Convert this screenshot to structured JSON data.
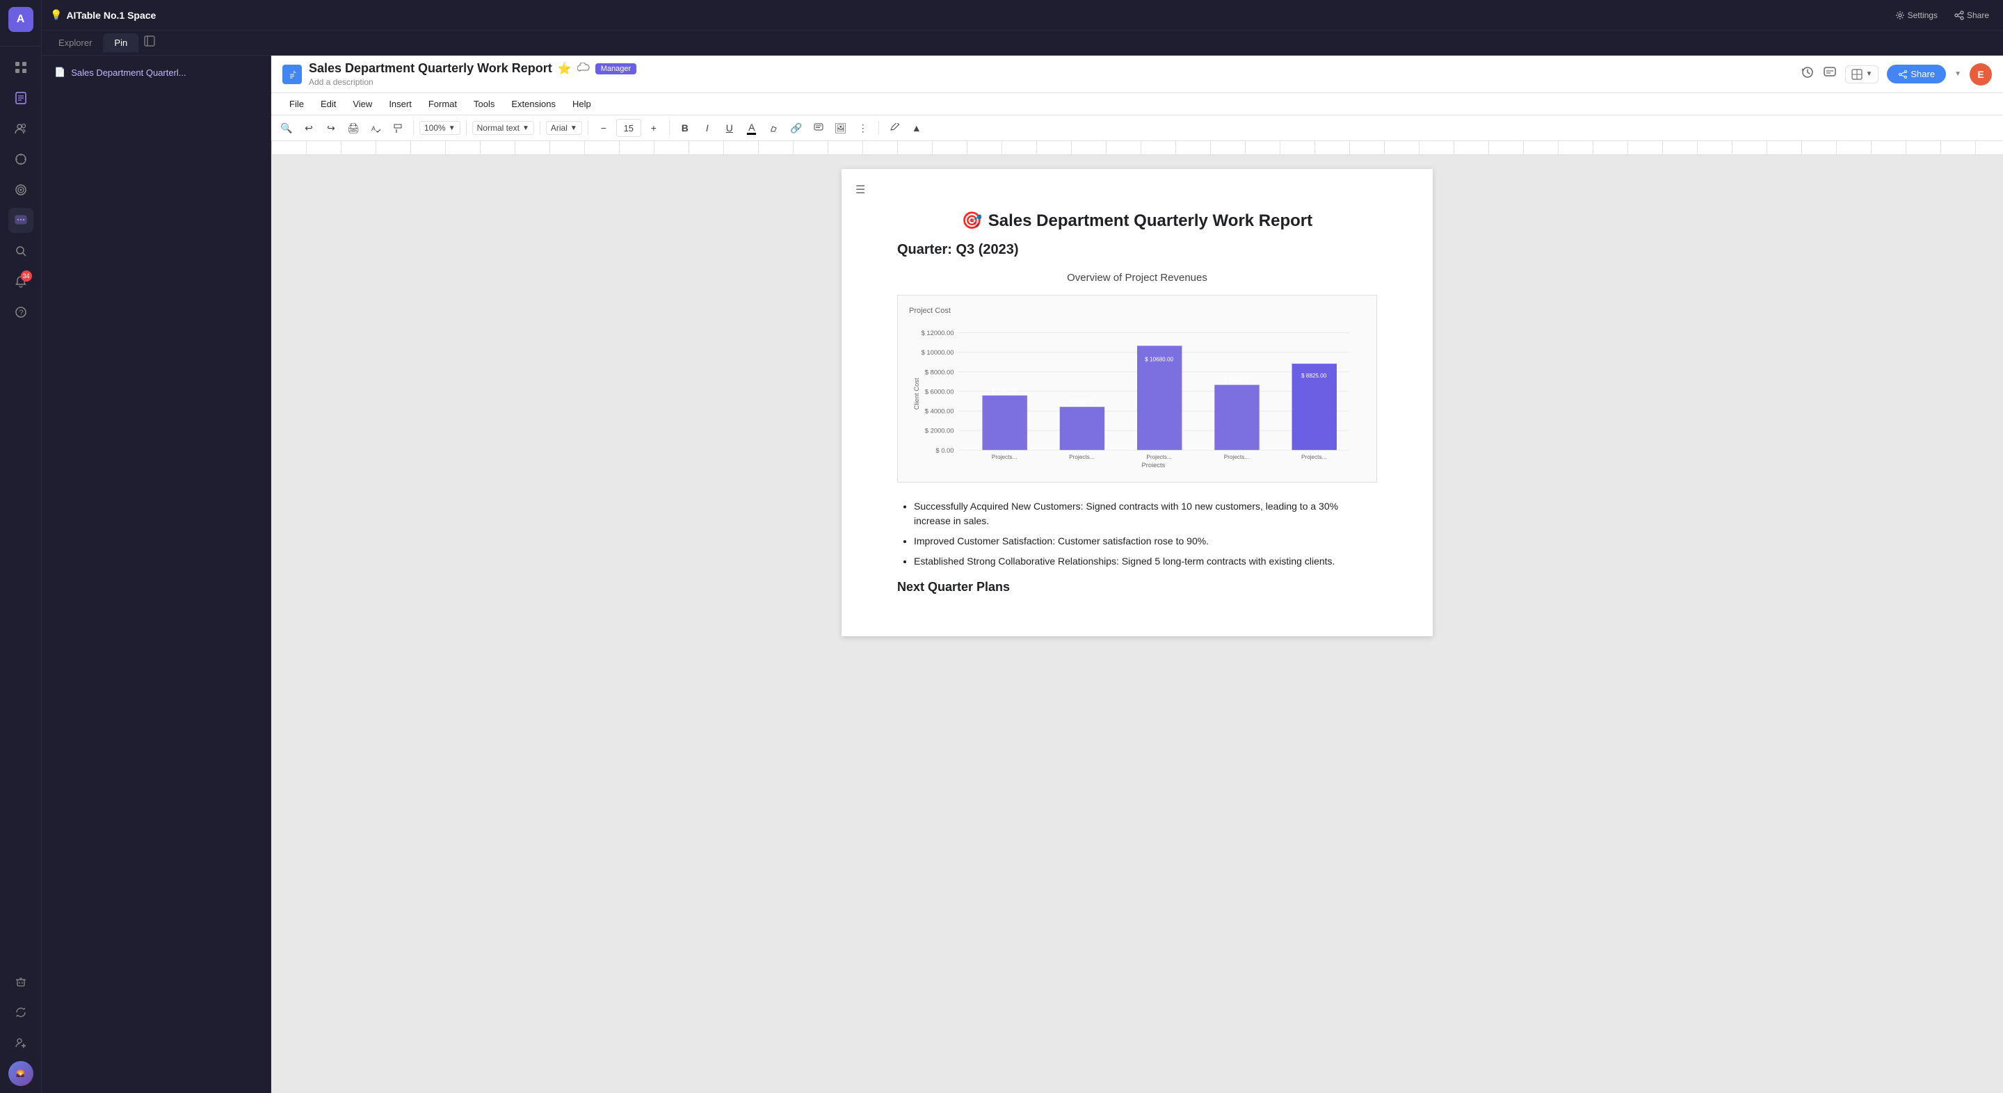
{
  "app": {
    "title": "AITable No.1 Space",
    "avatar_letter": "A"
  },
  "top_bar": {
    "title": "AITable No.1 Space",
    "settings_label": "Settings",
    "share_label": "Share"
  },
  "nav": {
    "explorer_label": "Explorer",
    "pin_label": "Pin"
  },
  "sidebar": {
    "icons": [
      "🏠",
      "📋",
      "👥",
      "🔭",
      "🎯",
      "💬",
      "🔍",
      "🔔",
      "❓"
    ]
  },
  "doc_nav": {
    "title": "Sales Department Quarterl...",
    "icon": "📄"
  },
  "document": {
    "title": "Sales Department Quarterly Work Report",
    "emoji": "🎯",
    "star": "★",
    "description_placeholder": "Add a description",
    "manager_badge": "Manager",
    "share_btn": "Share",
    "user_initial": "E",
    "quarter": "Quarter: Q3 (2023)",
    "chart_section_title": "Overview of Project Revenues",
    "chart_label": "Project Cost",
    "y_axis_label": "Client Cost",
    "x_axis_label": "Projects",
    "chart_bars": [
      {
        "label": "Projects...",
        "value": 5560,
        "display": "$ 5560.00"
      },
      {
        "label": "Projects...",
        "value": 4460,
        "display": "$ 4460.00"
      },
      {
        "label": "Projects...",
        "value": 10680,
        "display": "$ 10680.00"
      },
      {
        "label": "Projects...",
        "value": 6650,
        "display": "$ 6650.00"
      },
      {
        "label": "Projects...",
        "value": 8825,
        "display": "$ 8825.00"
      }
    ],
    "y_axis_values": [
      "$ 12000.00",
      "$ 10000.00",
      "$ 8000.00",
      "$ 6000.00",
      "$ 4000.00",
      "$ 2000.00",
      "$ 0.00"
    ],
    "bullet_points": [
      "Successfully Acquired New Customers: Signed contracts with 10 new customers, leading to a 30% increase in sales.",
      "Improved Customer Satisfaction: Customer satisfaction rose to 90%.",
      "Established Strong Collaborative Relationships: Signed 5 long-term contracts with existing clients."
    ],
    "next_quarter_heading": "Next Quarter Plans"
  },
  "toolbar": {
    "zoom": "100%",
    "text_style": "Normal text",
    "font": "Arial",
    "font_size": "15",
    "menu_items": [
      "File",
      "Edit",
      "View",
      "Insert",
      "Format",
      "Tools",
      "Extensions",
      "Help"
    ]
  },
  "colors": {
    "bar_fill": "#7c6fe0",
    "bar_fill_light": "#8b7fe8",
    "accent": "#6b5fe4",
    "doc_blue": "#4285f4"
  }
}
